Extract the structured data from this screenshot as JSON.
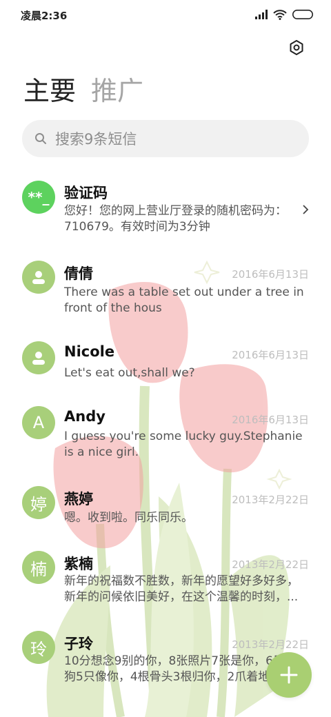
{
  "status_bar": {
    "time": "凌晨2:36"
  },
  "tabs": [
    {
      "label": "主要"
    },
    {
      "label": "推广"
    }
  ],
  "search": {
    "placeholder": "搜索9条短信"
  },
  "messages": [
    {
      "name": "验证码",
      "date": "",
      "avatar": "**_",
      "preview": "您好！您的网上营业厅登录的随机密码为：710679。有效时间为3分钟"
    },
    {
      "name": "倩倩",
      "date": "2016年6月13日",
      "avatar": "person-icon",
      "preview": "There was a table set out under a tree in front of the hous"
    },
    {
      "name": "Nicole",
      "date": "2016年6月13日",
      "avatar": "person-icon",
      "preview": "Let's eat out,shall we?"
    },
    {
      "name": "Andy",
      "date": "2016年6月13日",
      "avatar": "A",
      "preview": "I guess you're some lucky guy.Stephanie is a nice girl."
    },
    {
      "name": "燕婷",
      "date": "2013年2月22日",
      "avatar": "婷",
      "preview": "嗯。收到啦。同乐同乐。"
    },
    {
      "name": "紫楠",
      "date": "2013年2月22日",
      "avatar": "楠",
      "preview": "新年的祝福数不胜数，新年的愿望好多好多，新年的问候依旧美好，在这个温馨的时刻，..."
    },
    {
      "name": "子玲",
      "date": "2013年2月22日",
      "avatar": "玲",
      "preview": "10分想念9别的你，8张照片7张是你，6只小狗5只像你，4根骨头3根归你，2爪着地"
    }
  ],
  "icons": {
    "settings": "gear-icon",
    "search": "search-icon",
    "compose": "plus-icon",
    "chevron": "chevron-right-icon"
  },
  "colors": {
    "accent": "#a8cf7a",
    "verify_avatar": "#5dd25e"
  }
}
